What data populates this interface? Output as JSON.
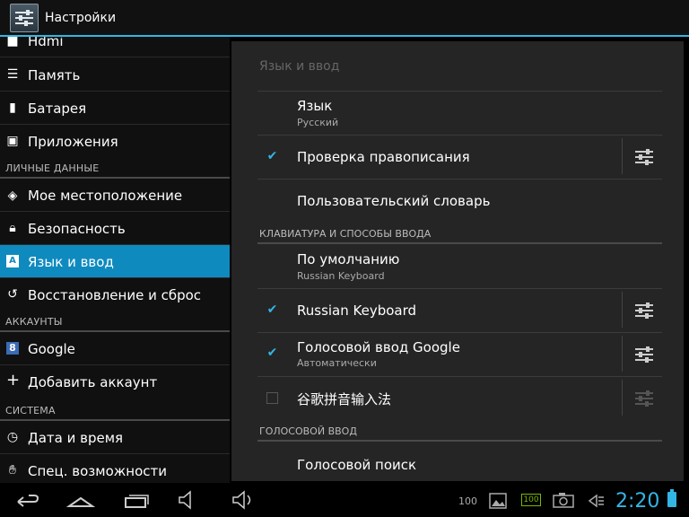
{
  "action_bar": {
    "title": "Настройки",
    "icon": "settings-app-icon"
  },
  "sidebar": {
    "items": [
      {
        "label": "Hdmi",
        "icon": "hdmi-icon"
      },
      {
        "label": "Память",
        "icon": "storage-icon"
      },
      {
        "label": "Батарея",
        "icon": "battery-icon"
      },
      {
        "label": "Приложения",
        "icon": "apps-icon"
      },
      {
        "label": "Мое местоположение",
        "icon": "location-icon"
      },
      {
        "label": "Безопасность",
        "icon": "lock-icon"
      },
      {
        "label": "Язык и ввод",
        "icon": "language-icon",
        "active": true
      },
      {
        "label": "Восстановление и сброс",
        "icon": "reset-icon"
      },
      {
        "label": "Google",
        "icon": "google-icon"
      },
      {
        "label": "Добавить аккаунт",
        "icon": "plus-icon"
      },
      {
        "label": "Дата и время",
        "icon": "clock-icon"
      },
      {
        "label": "Спец. возможности",
        "icon": "hand-icon"
      }
    ],
    "headers": {
      "personal": "ЛИЧНЫЕ ДАННЫЕ",
      "accounts": "АККАУНТЫ",
      "system": "СИСТЕМА"
    }
  },
  "panel": {
    "title": "Язык и ввод",
    "language": {
      "title": "Язык",
      "value": "Русский"
    },
    "spellcheck": {
      "title": "Проверка правописания",
      "checked": true
    },
    "user_dictionary": {
      "title": "Пользовательский словарь"
    },
    "keyboard_header": "КЛАВИАТУРА И СПОСОБЫ ВВОДА",
    "default": {
      "title": "По умолчанию",
      "value": "Russian Keyboard"
    },
    "russian_keyboard": {
      "title": "Russian Keyboard",
      "checked": true
    },
    "google_voice": {
      "title": "Голосовой ввод Google",
      "value": "Автоматически",
      "checked": true
    },
    "pinyin": {
      "title": "谷歌拼音输入法",
      "checked": false
    },
    "voice_header": "ГОЛОСОВОЙ ВВОД",
    "voice_search": {
      "title": "Голосовой поиск"
    }
  },
  "status": {
    "signal_text": "100",
    "battery_badge": "100",
    "time": "2:20"
  },
  "colors": {
    "accent": "#33b5e5",
    "selected": "#0f8abf"
  }
}
